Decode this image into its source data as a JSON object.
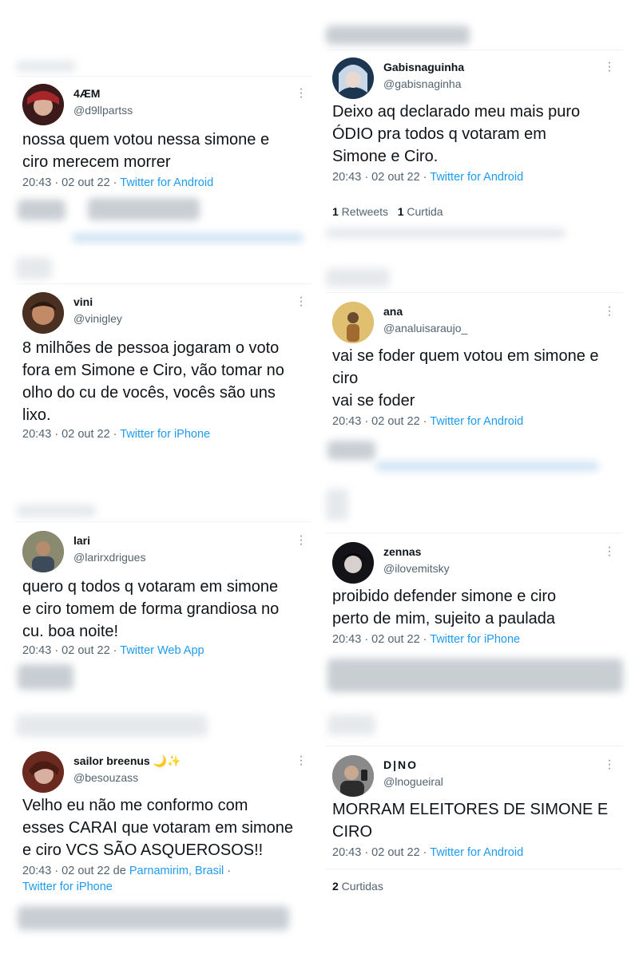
{
  "tweets": [
    {
      "name": "4ÆM",
      "handle": "@d9llpartss",
      "text": [
        "nossa quem votou nessa simone e",
        "ciro merecem morrer"
      ],
      "time": "20:43 · 02 out 22 · ",
      "client": "Twitter for Android",
      "avatar_color": "#7a2a2a"
    },
    {
      "name": "vini",
      "handle": "@vinigley",
      "text": [
        "8 milhões de pessoa jogaram o voto",
        "fora em Simone e Ciro, vão tomar no",
        "olho do cu de vocês, vocês são uns",
        "lixo."
      ],
      "time": "20:43 · 02 out 22 · ",
      "client": "Twitter for iPhone",
      "avatar_color": "#5a3b2c"
    },
    {
      "name": "lari",
      "handle": "@larirxdrigues",
      "text": [
        "quero q todos q votaram em simone",
        "e ciro tomem de forma grandiosa no",
        "cu. boa noite!"
      ],
      "time": "20:43 · 02 out 22 · ",
      "client": "Twitter Web App",
      "avatar_color": "#6b6f5a"
    },
    {
      "name": "sailor breenus",
      "name_emoji": "🌙✨",
      "handle": "@besouzass",
      "text": [
        "Velho eu não me conformo com",
        "esses CARAI que votaram em simone",
        "e ciro VCS SÃO ASQUEROSOS!!"
      ],
      "time": "20:43 · 02 out 22 de ",
      "location": "Parnamirim, Brasil",
      "time_tail": " ·",
      "client": "Twitter for iPhone",
      "avatar_color": "#8c3a2e"
    },
    {
      "name": "Gabisnaguinha",
      "handle": "@gabisnaginha",
      "text": [
        "Deixo aq declarado meu mais puro",
        "ÓDIO pra todos q votaram em",
        "Simone e Ciro."
      ],
      "time": "20:43 · 02 out 22 · ",
      "client": "Twitter for Android",
      "retweets_count": "1",
      "retweets_label": " Retweets",
      "likes_count": "1",
      "likes_label": " Curtida",
      "avatar_color": "#2e4f6e"
    },
    {
      "name": "ana",
      "handle": "@analuisaraujo_",
      "text": [
        "vai se foder quem votou em simone e",
        "ciro",
        "vai se foder"
      ],
      "time": "20:43 · 02 out 22 · ",
      "client": "Twitter for Android",
      "avatar_color": "#c9a24a"
    },
    {
      "name": "zennas",
      "handle": "@ilovemitsky",
      "text": [
        "proibido defender simone e ciro",
        "perto de mim, sujeito a paulada"
      ],
      "time": "20:43 · 02 out 22 · ",
      "client": "Twitter for iPhone",
      "avatar_color": "#1e1e22"
    },
    {
      "name": "D|NO",
      "handle": "@lnogueiral",
      "text": [
        "MORRAM ELEITORES DE SIMONE E",
        "CIRO"
      ],
      "time": "20:43 · 02 out 22 · ",
      "client": "Twitter for Android",
      "likes_count": "2",
      "likes_label": " Curtidas",
      "avatar_color": "#5c5c5c"
    }
  ],
  "colors": {
    "link": "#1d9bf0",
    "secondary_text": "#536471",
    "primary_text": "#0f1419"
  }
}
